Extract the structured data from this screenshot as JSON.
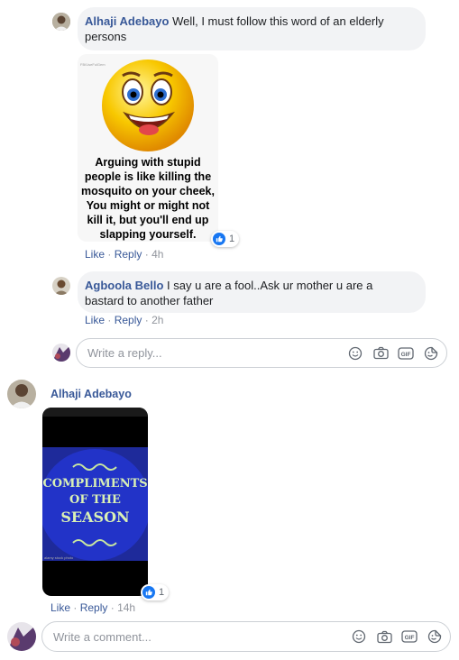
{
  "comment1": {
    "author": "Alhaji Adebayo",
    "text_line1": "Well, I must follow this word of an elderly",
    "text_line2": "persons",
    "image_caption_lines": [
      "Arguing with stupid",
      "people is like killing the",
      "mosquito on your cheek,",
      "You might or might not",
      "kill it, but you'll end up",
      "slapping yourself."
    ],
    "image_watermark": "FB/UseFulGem",
    "reaction_count": "1",
    "actions": {
      "like": "Like",
      "reply": "Reply",
      "time": "4h"
    }
  },
  "comment2": {
    "author": "Agboola Bello",
    "text_line1": "I say u are a fool..Ask ur mother u are a",
    "text_line2": "bastard to another father",
    "actions": {
      "like": "Like",
      "reply": "Reply",
      "time": "2h"
    }
  },
  "reply_box": {
    "placeholder": "Write a reply..."
  },
  "comment3": {
    "author": "Alhaji Adebayo",
    "image_text_lines": [
      "COMPLIMENTS",
      "OF THE",
      "SEASON"
    ],
    "image_credit": "alamy stock photo",
    "reaction_count": "1",
    "actions": {
      "like": "Like",
      "reply": "Reply",
      "time": "14h"
    }
  },
  "comment_box": {
    "placeholder": "Write a comment..."
  },
  "colors": {
    "link": "#385898",
    "like_blue": "#1877f2",
    "bubble": "#f2f3f5",
    "season_bg": "#2233c8"
  },
  "input_icons": [
    "emoji-icon",
    "camera-icon",
    "gif-icon",
    "sticker-icon"
  ]
}
